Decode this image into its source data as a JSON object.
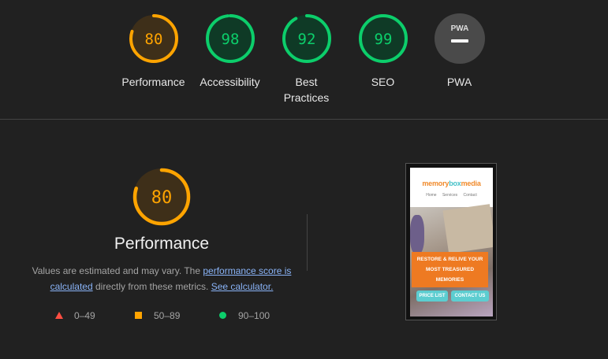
{
  "categories": [
    {
      "id": "performance",
      "score": "80",
      "label": "Performance",
      "percent": 80,
      "status": "average"
    },
    {
      "id": "accessibility",
      "score": "98",
      "label": "Accessibility",
      "percent": 98,
      "status": "pass"
    },
    {
      "id": "best-practices",
      "score": "92",
      "label": "Best Practices",
      "label_lines": [
        "Best",
        "Practices"
      ],
      "percent": 92,
      "status": "pass"
    },
    {
      "id": "seo",
      "score": "99",
      "label": "SEO",
      "percent": 99,
      "status": "pass"
    },
    {
      "id": "pwa",
      "score": "",
      "label": "PWA",
      "badge": "PWA",
      "status": "pwa"
    }
  ],
  "colors": {
    "pass": "#0cce6b",
    "pass_bg": "#0f3a26",
    "average": "#ffa400",
    "average_bg": "#3e2f19",
    "fail": "#ff4e42",
    "pwa_bg": "#4a4a4a",
    "link": "#8ab4f8"
  },
  "performance": {
    "score": "80",
    "percent": 80,
    "title": "Performance",
    "desc_prefix": "Values are estimated and may vary. The ",
    "score_link": "performance score is calculated",
    "desc_middle": " directly from these metrics. ",
    "calc_link": "See calculator."
  },
  "legend": [
    {
      "shape": "triangle",
      "range": "0–49"
    },
    {
      "shape": "square",
      "range": "50–89"
    },
    {
      "shape": "circle",
      "range": "90–100"
    }
  ],
  "screenshot": {
    "logo_part1": "memory",
    "logo_part2": "box",
    "logo_part3": "media",
    "nav": [
      "Home",
      "Services",
      "Contact"
    ],
    "banner_lines": [
      "RESTORE & RELIVE YOUR",
      "MOST TREASURED",
      "MEMORIES"
    ],
    "btn_price": "PRICE LIST",
    "btn_contact": "CONTACT US"
  }
}
